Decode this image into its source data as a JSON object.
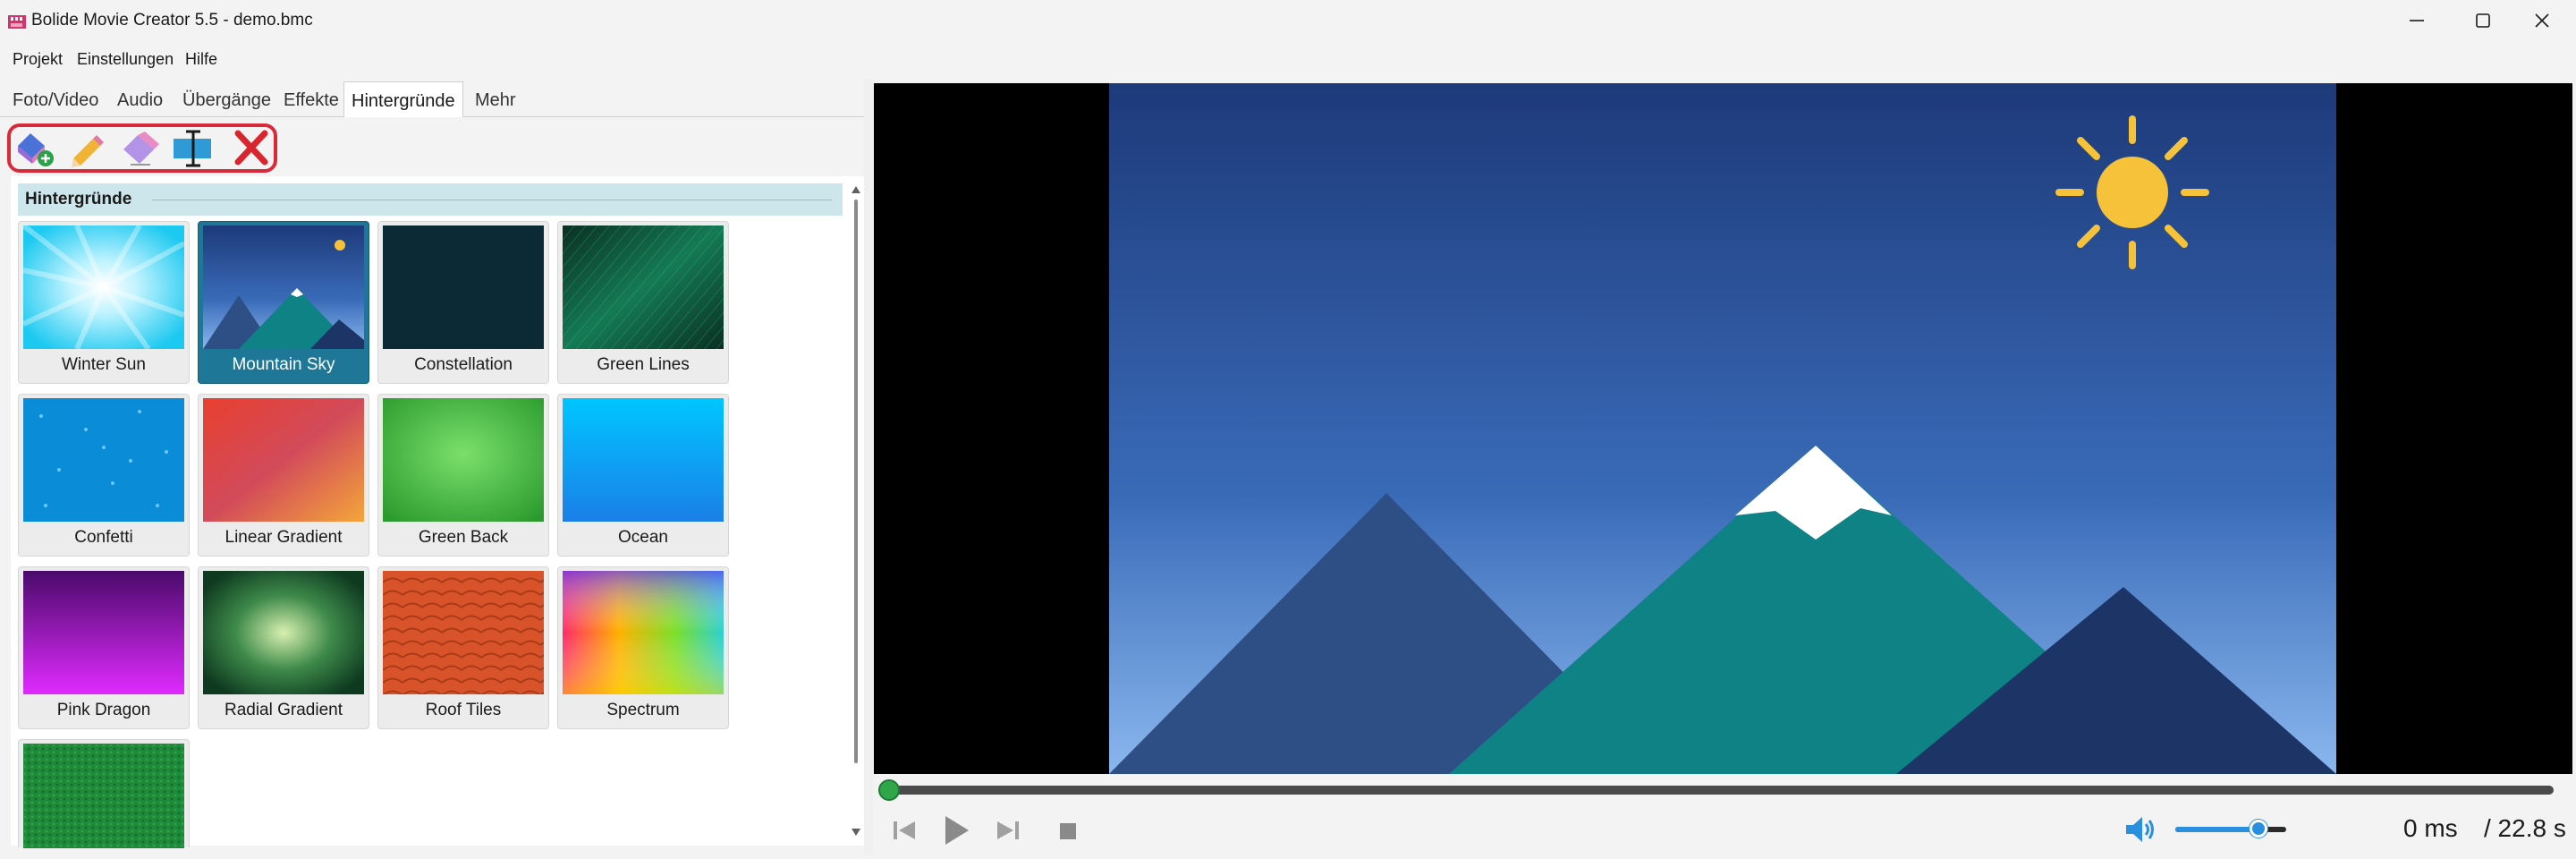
{
  "window": {
    "title": "Bolide Movie Creator 5.5 - demo.bmc",
    "icon": "app-logo-icon",
    "controls": [
      "minimize-icon",
      "maximize-icon",
      "close-icon"
    ]
  },
  "menu": {
    "items": [
      "Projekt",
      "Einstellungen",
      "Hilfe"
    ]
  },
  "tabs": [
    {
      "label": "Foto/Video",
      "active": false
    },
    {
      "label": "Audio",
      "active": false
    },
    {
      "label": "Übergänge",
      "active": false
    },
    {
      "label": "Effekte",
      "active": false
    },
    {
      "label": "Hintergründe",
      "active": true
    },
    {
      "label": "Mehr",
      "active": false
    }
  ],
  "toolbar": {
    "tools": [
      "add-background-icon",
      "edit-pencil-icon",
      "eraser-icon",
      "text-insert-icon",
      "delete-icon"
    ]
  },
  "backgrounds": {
    "group_title": "Hintergründe",
    "selected": "Mountain Sky",
    "items": [
      {
        "label": "Winter Sun"
      },
      {
        "label": "Mountain Sky"
      },
      {
        "label": "Constellation"
      },
      {
        "label": "Green Lines"
      },
      {
        "label": "Confetti"
      },
      {
        "label": "Linear Gradient"
      },
      {
        "label": "Green Back"
      },
      {
        "label": "Ocean"
      },
      {
        "label": "Pink Dragon"
      },
      {
        "label": "Radial Gradient"
      },
      {
        "label": "Roof Tiles"
      },
      {
        "label": "Spectrum"
      },
      {
        "label": ""
      }
    ]
  },
  "player": {
    "position_fraction": 0.0,
    "volume_fraction": 0.75,
    "time_current": "0 ms",
    "time_total": "/ 22.8 s",
    "controls": [
      "previous-frame-icon",
      "play-icon",
      "next-frame-icon",
      "stop-icon",
      "volume-icon"
    ]
  },
  "colors": {
    "accent_selected": "#1e7796",
    "highlight_border": "#d72b3a",
    "seek_handle": "#2fa64a",
    "volume": "#2b8fe0"
  }
}
